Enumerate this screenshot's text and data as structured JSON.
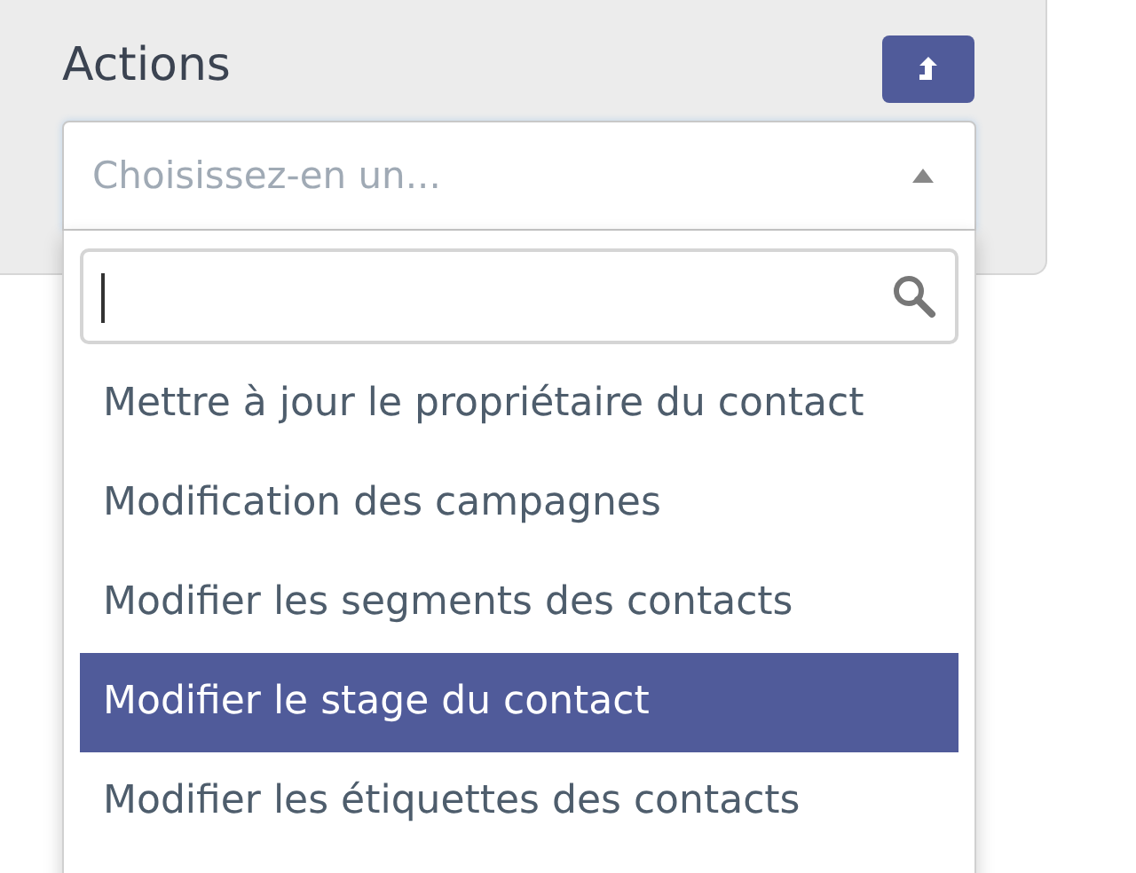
{
  "panel": {
    "title": "Actions"
  },
  "select": {
    "placeholder": "Choisissez-en un...",
    "expanded": true
  },
  "options": [
    {
      "label": "Mettre à jour le propriétaire du contact",
      "selected": false
    },
    {
      "label": "Modification des campagnes",
      "selected": false
    },
    {
      "label": "Modifier les segments des contacts",
      "selected": false
    },
    {
      "label": "Modifier le stage du contact",
      "selected": true
    },
    {
      "label": "Modifier les étiquettes des contacts",
      "selected": false
    }
  ]
}
